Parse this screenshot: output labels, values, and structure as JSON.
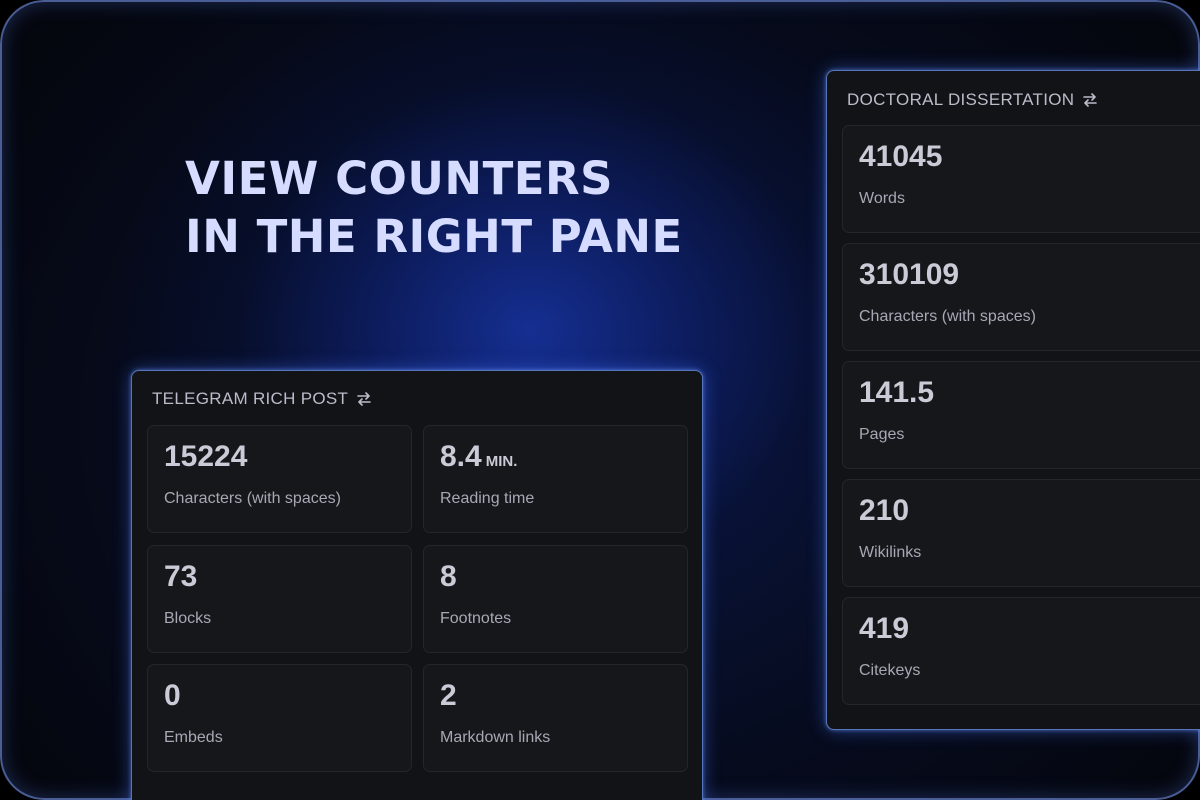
{
  "headline": {
    "line1": "VIEW COUNTERS",
    "line2": "IN THE RIGHT PANE"
  },
  "telegram": {
    "title": "TELEGRAM RICH POST",
    "icon": "swap-icon",
    "cards": [
      {
        "value": "15224",
        "unit": "",
        "label": "Characters (with spaces)"
      },
      {
        "value": "8.4",
        "unit": "MIN.",
        "label": "Reading time"
      },
      {
        "value": "73",
        "unit": "",
        "label": "Blocks"
      },
      {
        "value": "8",
        "unit": "",
        "label": "Footnotes"
      },
      {
        "value": "0",
        "unit": "",
        "label": "Embeds"
      },
      {
        "value": "2",
        "unit": "",
        "label": "Markdown links"
      }
    ]
  },
  "dissertation": {
    "title": "DOCTORAL DISSERTATION",
    "icon": "swap-icon",
    "cards": [
      {
        "value": "41045",
        "label": "Words"
      },
      {
        "value": "310109",
        "label": "Characters (with spaces)"
      },
      {
        "value": "141.5",
        "label": "Pages"
      },
      {
        "value": "210",
        "label": "Wikilinks"
      },
      {
        "value": "419",
        "label": "Citekeys"
      }
    ]
  },
  "colors": {
    "accent_glow": "#4670ff",
    "headline": "#d6dcff",
    "pane_bg": "#121317",
    "card_bg": "#16171b"
  }
}
